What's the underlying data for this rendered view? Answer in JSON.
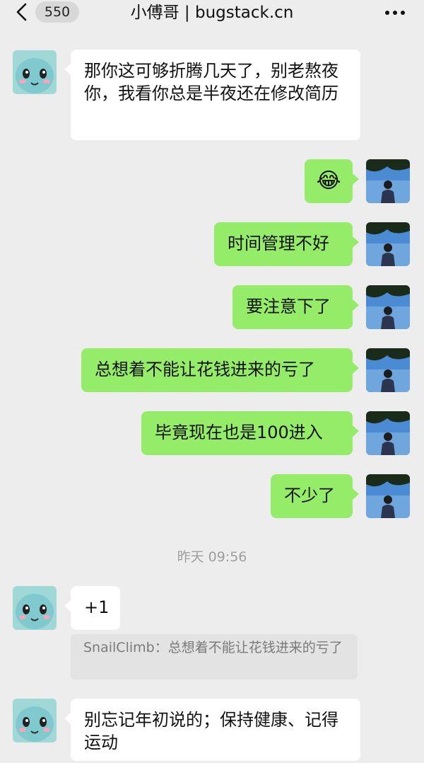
{
  "header": {
    "unread_count": "550",
    "title": "小傅哥 | bugstack.cn"
  },
  "messages": [
    {
      "side": "left",
      "text": "那你这可够折腾几天了，别老熬夜你，我看你总是半夜还在修改简历"
    },
    {
      "side": "right",
      "text": "😂",
      "type": "emoji"
    },
    {
      "side": "right",
      "text": "时间管理不好"
    },
    {
      "side": "right",
      "text": "要注意下了"
    },
    {
      "side": "right",
      "text": "总想着不能让花钱进来的亏了"
    },
    {
      "side": "right",
      "text": "毕竟现在也是100进入"
    },
    {
      "side": "right",
      "text": "不少了"
    },
    {
      "side": "left",
      "text": "+1"
    },
    {
      "side": "left",
      "text": "别忘记年初说的；保持健康、记得运动"
    }
  ],
  "timestamp": "昨天 09:56",
  "quote": {
    "text": "SnailClimb：总想着不能让花钱进来的亏了"
  },
  "colors": {
    "background": "#ededed",
    "self_bubble": "#95ec69",
    "other_bubble": "#ffffff"
  }
}
